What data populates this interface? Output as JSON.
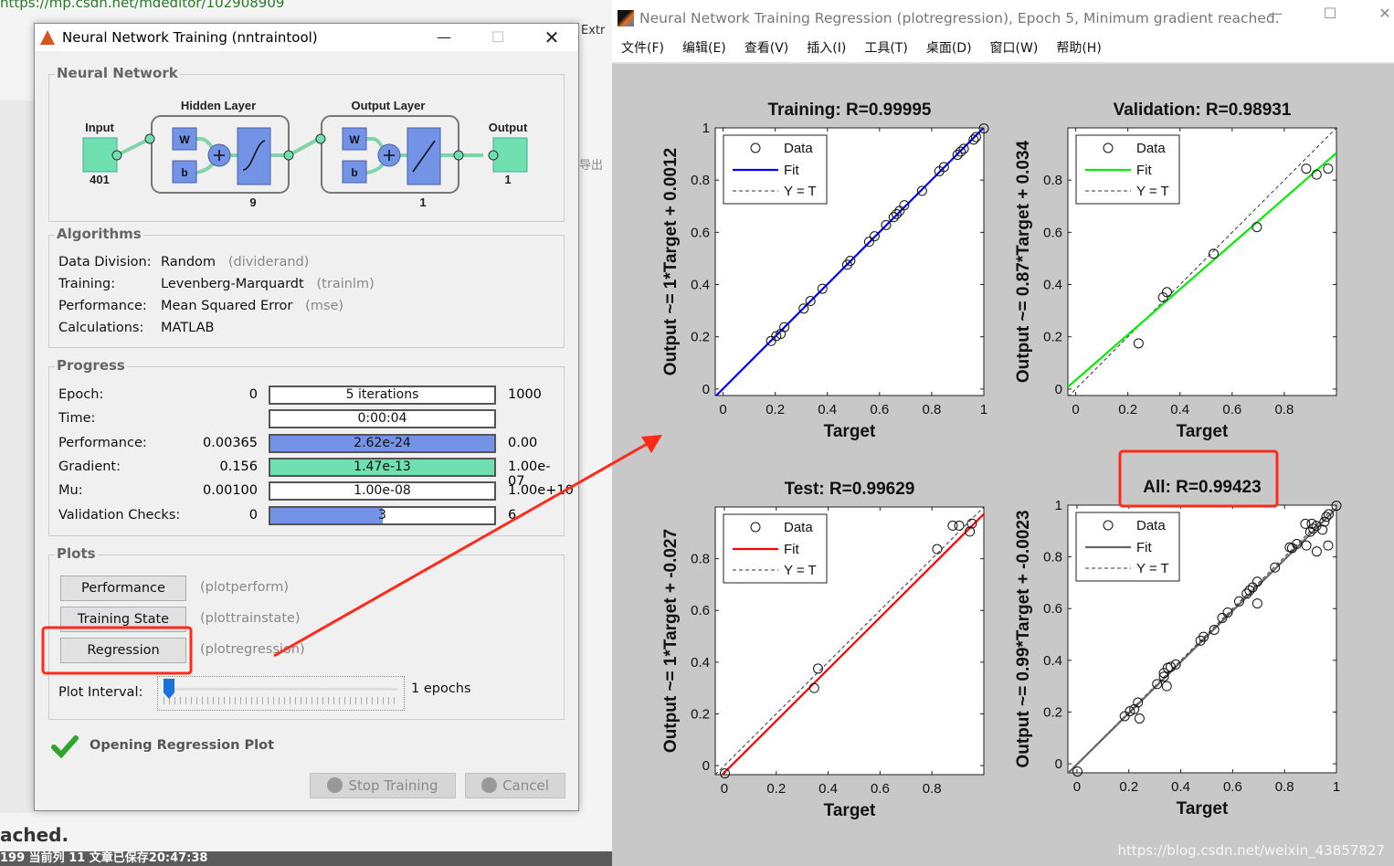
{
  "background": {
    "url": "https://mp.csdn.net/mdeditor/102908909",
    "ext": "Extr",
    "export_label": "导出",
    "partial_text": "ached.",
    "status_bar": "199  当前列 11  文章已保存20:47:38",
    "watermark": "https://blog.csdn.net/weixin_43857827"
  },
  "dialog": {
    "title": "Neural Network Training (nntraintool)",
    "network": {
      "group": "Neural Network",
      "input_label": "Input",
      "input_size": "401",
      "hidden_label": "Hidden Layer",
      "hidden_size": "9",
      "output_layer_label": "Output Layer",
      "output_layer_size": "1",
      "output_label": "Output",
      "output_size": "1",
      "w": "W",
      "b": "b"
    },
    "algorithms": {
      "group": "Algorithms",
      "rows": [
        {
          "label": "Data Division:",
          "value": "Random",
          "fn": "(dividerand)"
        },
        {
          "label": "Training:",
          "value": "Levenberg-Marquardt",
          "fn": "(trainlm)"
        },
        {
          "label": "Performance:",
          "value": "Mean Squared Error",
          "fn": "(mse)"
        },
        {
          "label": "Calculations:",
          "value": "MATLAB",
          "fn": ""
        }
      ]
    },
    "progress": {
      "group": "Progress",
      "rows": [
        {
          "label": "Epoch:",
          "start": "0",
          "current": "5 iterations",
          "end": "1000",
          "fill": 0,
          "color": "#ffffff"
        },
        {
          "label": "Time:",
          "start": "",
          "current": "0:00:04",
          "end": "",
          "fill": 0,
          "color": "#ffffff"
        },
        {
          "label": "Performance:",
          "start": "0.00365",
          "current": "2.62e-24",
          "end": "0.00",
          "fill": 1,
          "color": "#7393e6"
        },
        {
          "label": "Gradient:",
          "start": "0.156",
          "current": "1.47e-13",
          "end": "1.00e-07",
          "fill": 1,
          "color": "#70e0b0"
        },
        {
          "label": "Mu:",
          "start": "0.00100",
          "current": "1.00e-08",
          "end": "1.00e+10",
          "fill": 0,
          "color": "#ffffff"
        },
        {
          "label": "Validation Checks:",
          "start": "0",
          "current": "3",
          "end": "6",
          "fill": 0.5,
          "color": "#7393e6"
        }
      ]
    },
    "plots": {
      "group": "Plots",
      "buttons": [
        {
          "label": "Performance",
          "fn": "(plotperform)"
        },
        {
          "label": "Training State",
          "fn": "(plottrainstate)"
        },
        {
          "label": "Regression",
          "fn": "(plotregression)"
        }
      ],
      "interval_label": "Plot Interval:",
      "interval_value": "1 epochs",
      "interval_fraction": 0
    },
    "status": "Opening Regression Plot",
    "stop_label": "Stop Training",
    "cancel_label": "Cancel"
  },
  "figure": {
    "title": "Neural Network Training Regression (plotregression), Epoch 5, Minimum gradient reached.",
    "menu": [
      "文件(F)",
      "编辑(E)",
      "查看(V)",
      "插入(I)",
      "工具(T)",
      "桌面(D)",
      "窗口(W)",
      "帮助(H)"
    ],
    "legend": {
      "data": "Data",
      "fit": "Fit",
      "ident": "Y = T"
    }
  },
  "annotation_color": "#ff2a1a",
  "chart_data": [
    {
      "type": "scatter",
      "title": "Training: R=0.99995",
      "xlabel": "Target",
      "ylabel": "Output ~= 1*Target + 0.0012",
      "fit": {
        "slope": 1,
        "intercept": 0.0012,
        "color": "#0000ff"
      },
      "xlim": [
        -0.03,
        1
      ],
      "ylim": [
        -0.025,
        1
      ],
      "xticks": [
        "0",
        "0.2",
        "0.4",
        "0.6",
        "0.8",
        "1"
      ],
      "yticks": [
        "0",
        "0.2",
        "0.4",
        "0.6",
        "0.8",
        "1"
      ],
      "legend": "top-left",
      "points": [
        [
          0.184,
          0.184
        ],
        [
          0.204,
          0.203
        ],
        [
          0.221,
          0.211
        ],
        [
          0.235,
          0.237
        ],
        [
          0.309,
          0.308
        ],
        [
          0.335,
          0.337
        ],
        [
          0.381,
          0.384
        ],
        [
          0.476,
          0.476
        ],
        [
          0.488,
          0.491
        ],
        [
          0.56,
          0.564
        ],
        [
          0.581,
          0.585
        ],
        [
          0.625,
          0.628
        ],
        [
          0.654,
          0.658
        ],
        [
          0.665,
          0.67
        ],
        [
          0.677,
          0.682
        ],
        [
          0.695,
          0.704
        ],
        [
          0.763,
          0.759
        ],
        [
          0.829,
          0.834
        ],
        [
          0.847,
          0.85
        ],
        [
          0.899,
          0.897
        ],
        [
          0.911,
          0.909
        ],
        [
          0.923,
          0.92
        ],
        [
          0.961,
          0.955
        ],
        [
          0.97,
          0.965
        ],
        [
          1.0,
          0.998
        ]
      ]
    },
    {
      "type": "scatter",
      "title": "Validation: R=0.98931",
      "xlabel": "Target",
      "ylabel": "Output ~= 0.87*Target + 0.034",
      "fit": {
        "slope": 0.87,
        "intercept": 0.034,
        "color": "#00ee00"
      },
      "xlim": [
        -0.03,
        1
      ],
      "ylim": [
        -0.025,
        1
      ],
      "xticks": [
        "0",
        "0.2",
        "0.4",
        "0.6",
        "0.8"
      ],
      "yticks": [
        "0",
        "0.2",
        "0.4",
        "0.6",
        "0.8"
      ],
      "legend": "top-left",
      "points": [
        [
          0.241,
          0.175
        ],
        [
          0.335,
          0.351
        ],
        [
          0.35,
          0.371
        ],
        [
          0.529,
          0.518
        ],
        [
          0.695,
          0.62
        ],
        [
          0.884,
          0.844
        ],
        [
          0.924,
          0.821
        ],
        [
          0.968,
          0.844
        ]
      ]
    },
    {
      "type": "scatter",
      "title": "Test: R=0.99629",
      "xlabel": "Target",
      "ylabel": "Output ~= 1*Target + -0.027",
      "fit": {
        "slope": 1,
        "intercept": -0.027,
        "color": "#ff0000"
      },
      "xlim": [
        -0.035,
        1
      ],
      "ylim": [
        -0.035,
        1
      ],
      "xticks": [
        "0",
        "0.2",
        "0.4",
        "0.6",
        "0.8"
      ],
      "yticks": [
        "0",
        "0.2",
        "0.4",
        "0.6",
        "0.8"
      ],
      "legend": "top-left",
      "points": [
        [
          0.002,
          -0.03
        ],
        [
          0.346,
          0.3
        ],
        [
          0.361,
          0.375
        ],
        [
          0.82,
          0.837
        ],
        [
          0.88,
          0.928
        ],
        [
          0.905,
          0.928
        ],
        [
          0.954,
          0.936
        ],
        [
          0.946,
          0.905
        ]
      ]
    },
    {
      "type": "scatter",
      "title": "All: R=0.99423",
      "xlabel": "Target",
      "ylabel": "Output ~= 0.99*Target + -0.0023",
      "fit": {
        "slope": 0.99,
        "intercept": -0.0023,
        "color": "#666666"
      },
      "xlim": [
        -0.035,
        1
      ],
      "ylim": [
        -0.035,
        1
      ],
      "xticks": [
        "0",
        "0.2",
        "0.4",
        "0.6",
        "0.8",
        "1"
      ],
      "yticks": [
        "0",
        "0.2",
        "0.4",
        "0.6",
        "0.8",
        "1"
      ],
      "legend": "top-left",
      "points": [
        [
          0.002,
          -0.03
        ],
        [
          0.184,
          0.184
        ],
        [
          0.204,
          0.203
        ],
        [
          0.221,
          0.211
        ],
        [
          0.235,
          0.237
        ],
        [
          0.241,
          0.175
        ],
        [
          0.309,
          0.308
        ],
        [
          0.335,
          0.337
        ],
        [
          0.335,
          0.351
        ],
        [
          0.346,
          0.3
        ],
        [
          0.35,
          0.371
        ],
        [
          0.361,
          0.375
        ],
        [
          0.381,
          0.384
        ],
        [
          0.476,
          0.476
        ],
        [
          0.488,
          0.491
        ],
        [
          0.529,
          0.518
        ],
        [
          0.56,
          0.564
        ],
        [
          0.581,
          0.585
        ],
        [
          0.625,
          0.628
        ],
        [
          0.654,
          0.658
        ],
        [
          0.665,
          0.67
        ],
        [
          0.677,
          0.682
        ],
        [
          0.695,
          0.62
        ],
        [
          0.695,
          0.704
        ],
        [
          0.763,
          0.759
        ],
        [
          0.82,
          0.837
        ],
        [
          0.829,
          0.834
        ],
        [
          0.847,
          0.85
        ],
        [
          0.88,
          0.928
        ],
        [
          0.884,
          0.844
        ],
        [
          0.899,
          0.897
        ],
        [
          0.905,
          0.928
        ],
        [
          0.911,
          0.909
        ],
        [
          0.923,
          0.92
        ],
        [
          0.924,
          0.821
        ],
        [
          0.946,
          0.905
        ],
        [
          0.954,
          0.936
        ],
        [
          0.961,
          0.955
        ],
        [
          0.968,
          0.844
        ],
        [
          0.97,
          0.965
        ],
        [
          1.0,
          0.998
        ]
      ]
    }
  ]
}
